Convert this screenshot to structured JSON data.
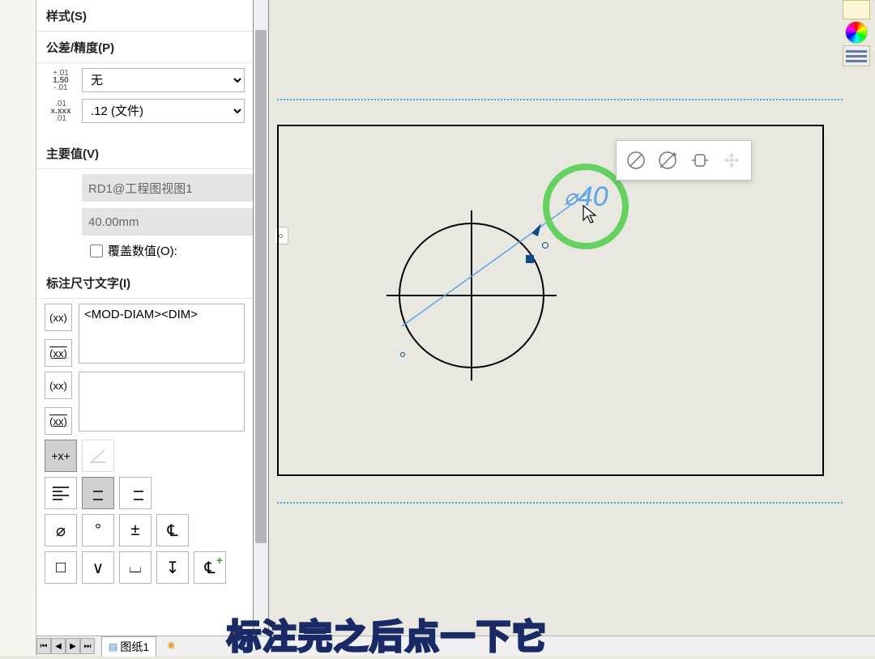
{
  "sections": {
    "style": "样式(S)",
    "tolerance": "公差/精度(P)",
    "primary": "主要值(V)",
    "dimtext": "标注尺寸文字(I)"
  },
  "tolerance": {
    "type_value": "无",
    "precision_value": ".12 (文件)"
  },
  "primary": {
    "name_value": "RD1@工程图视图1",
    "dim_value": "40.00mm",
    "override_label": "覆盖数值(O):"
  },
  "dimtext": {
    "text_value": "<MOD-DIAM><DIM>"
  },
  "canvas": {
    "dim_label": "40"
  },
  "tabs": {
    "sheet1": "图纸1"
  },
  "caption": "标注完之后点一下它"
}
